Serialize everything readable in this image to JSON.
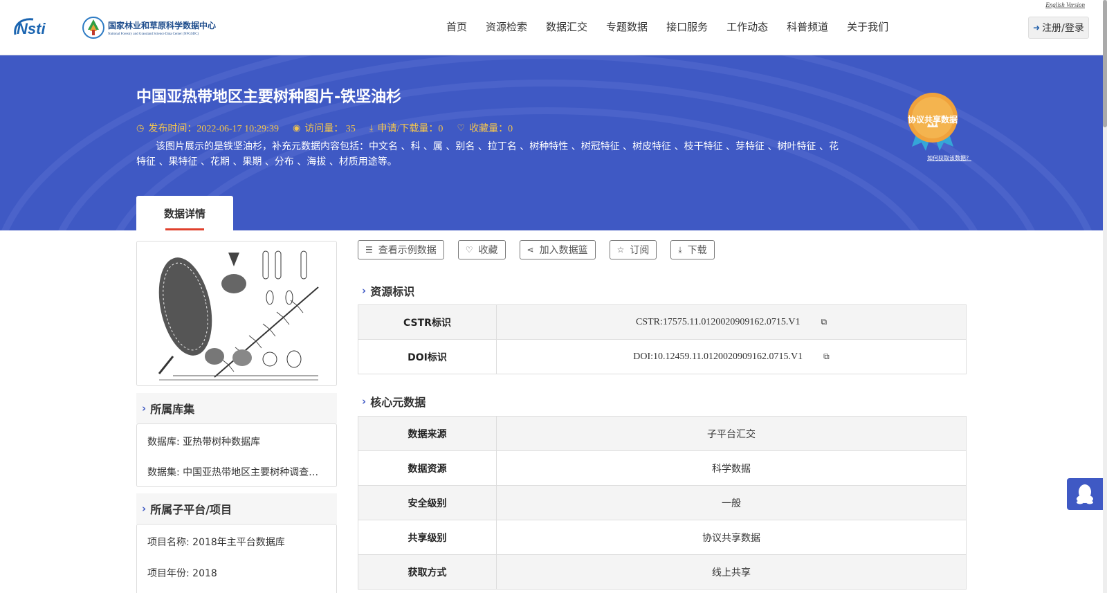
{
  "header": {
    "logo_text": "Nsti",
    "org_name_cn": "国家林业和草原科学数据中心",
    "org_name_en": "National Forestry and Grassland Science Data Center (NFGSDC)",
    "nav": [
      "首页",
      "资源检索",
      "数据汇交",
      "专题数据",
      "接口服务",
      "工作动态",
      "科普频道",
      "关于我们"
    ],
    "english_version": "English Version",
    "login": "注册/登录"
  },
  "banner": {
    "title": "中国亚热带地区主要树种图片-铁坚油杉",
    "publish_time": "发布时间：2022-06-17 10:29:39",
    "visits": "访问量： 35",
    "downloads": "申请/下载量：0",
    "favorites": "收藏量：0",
    "description": "该图片展示的是铁坚油杉，补充元数据内容包括：中文名 、科 、属 、别名 、拉丁名 、树种特性 、树冠特征 、树皮特征 、枝干特征 、芽特征 、树叶特征 、花特征 、果特征 、花期 、果期 、分布 、海拔 、材质用途等。",
    "badge_label": "协议共享数据",
    "badge_link": "如何获取该数据？",
    "tab": "数据详情"
  },
  "sidebar": {
    "database_heading": "所属库集",
    "database": "数据库: 亚热带树种数据库",
    "dataset": "数据集: 中国亚热带地区主要树种调查数据集",
    "project_heading": "所属子平台/项目",
    "project_name": "项目名称: 2018年主平台数据库",
    "project_year": "项目年份: 2018"
  },
  "actions": {
    "sample": "查看示例数据",
    "favorite": "收藏",
    "basket": "加入数据篮",
    "subscribe": "订阅",
    "download": "下载"
  },
  "resource_id": {
    "heading": "资源标识",
    "rows": [
      {
        "key": "CSTR标识",
        "value": "CSTR:17575.11.0120020909162.0715.V1"
      },
      {
        "key": "DOI标识",
        "value": "DOI:10.12459.11.0120020909162.0715.V1"
      }
    ]
  },
  "core_meta": {
    "heading": "核心元数据",
    "rows": [
      {
        "key": "数据来源",
        "value": "子平台汇交"
      },
      {
        "key": "数据资源",
        "value": "科学数据"
      },
      {
        "key": "安全级别",
        "value": "一般"
      },
      {
        "key": "共享级别",
        "value": "协议共享数据"
      },
      {
        "key": "获取方式",
        "value": "线上共享"
      }
    ]
  },
  "colors": {
    "banner": "#3f59c4",
    "meta_gold": "#f2c44f",
    "tab_underline": "#e0402c"
  }
}
